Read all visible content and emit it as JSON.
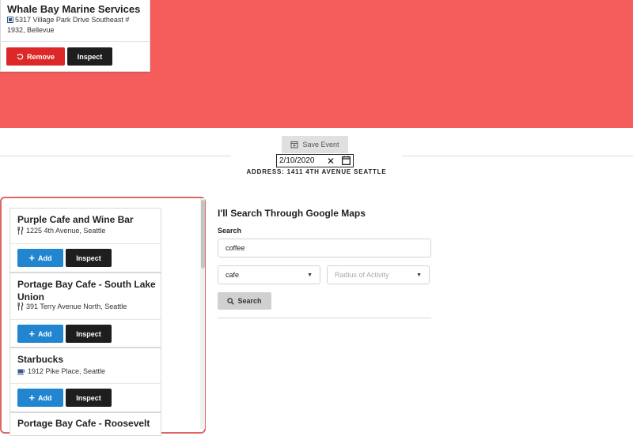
{
  "selected_place": {
    "name": "Whale Bay Marine Services",
    "address": "5317 Village Park Drive Southeast # 1932, Bellevue",
    "icon": "building-icon",
    "remove_label": "Remove",
    "inspect_label": "Inspect"
  },
  "colors": {
    "banner": "#f55d5d",
    "remove": "#dc2828",
    "add": "#2185d0",
    "inspect": "#1e1e1e"
  },
  "event": {
    "save_label": "Save Event",
    "date": "2/10/2020",
    "address": "ADDRESS: 1411 4TH AVENUE SEATTLE"
  },
  "results": [
    {
      "name": "Purple Cafe and Wine Bar",
      "address": "1225 4th Avenue, Seattle",
      "icon": "utensils-icon",
      "add_label": "Add",
      "inspect_label": "Inspect"
    },
    {
      "name": "Portage Bay Cafe - South Lake Union",
      "address": "391 Terry Avenue North, Seattle",
      "icon": "utensils-icon",
      "add_label": "Add",
      "inspect_label": "Inspect"
    },
    {
      "name": "Starbucks",
      "address": "1912 Pike Place, Seattle",
      "icon": "coffee-icon",
      "add_label": "Add",
      "inspect_label": "Inspect"
    },
    {
      "name": "Portage Bay Cafe - Roosevelt",
      "address": "",
      "icon": "",
      "add_label": "",
      "inspect_label": ""
    }
  ],
  "search": {
    "title": "I'll Search Through Google Maps",
    "label": "Search",
    "value": "coffee",
    "type_value": "cafe",
    "radius_placeholder": "Radius of Activity",
    "button_label": "Search"
  }
}
